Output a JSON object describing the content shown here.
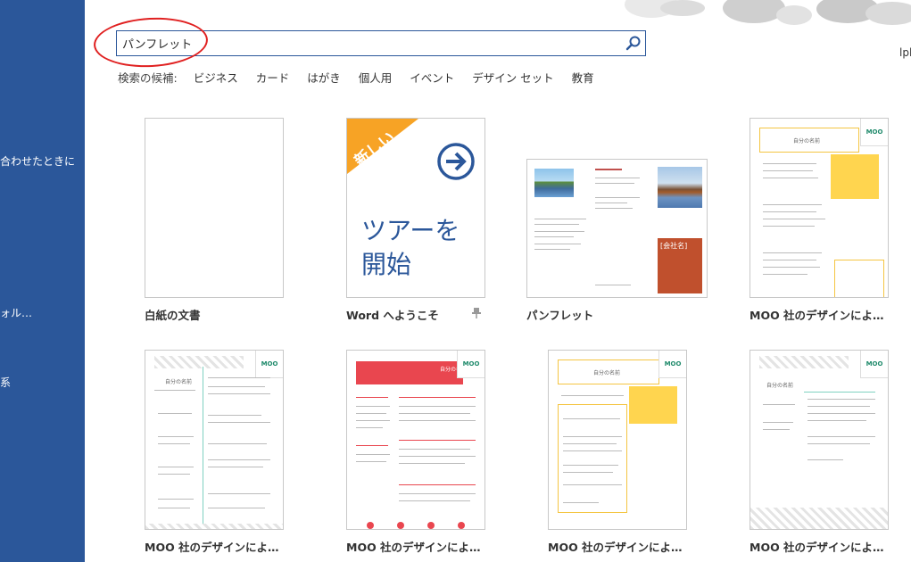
{
  "sidebar": {
    "fragments": [
      "合わせたときに",
      "ォル…",
      "系"
    ]
  },
  "search": {
    "value": "パンフレット",
    "placeholder": ""
  },
  "suggestions": {
    "label": "検索の候補:",
    "items": [
      "ビジネス",
      "カード",
      "はがき",
      "個人用",
      "イベント",
      "デザイン セット",
      "教育"
    ]
  },
  "user_fragment": "lpl",
  "templates": [
    {
      "caption": "白紙の文書"
    },
    {
      "caption": "Word へようこそ",
      "badge": "新しい",
      "tour_text_1": "ツアーを",
      "tour_text_2": "開始"
    },
    {
      "caption": "パンフレット",
      "company": "[会社名]"
    },
    {
      "caption": "MOO 社のデザインによ…",
      "name": "自分の名前",
      "brand": "MOO"
    },
    {
      "caption": "MOO 社のデザインによ…",
      "name": "自分の名前",
      "brand": "MOO"
    },
    {
      "caption": "MOO 社のデザインによ…",
      "name": "自分の名前",
      "brand": "MOO"
    },
    {
      "caption": "MOO 社のデザインによ…",
      "name": "自分の名前",
      "brand": "MOO"
    },
    {
      "caption": "MOO 社のデザインによ…",
      "name": "自分の名前",
      "brand": "MOO"
    }
  ]
}
